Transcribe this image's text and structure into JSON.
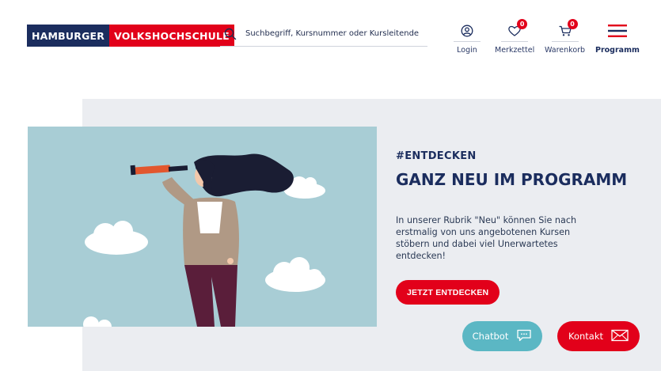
{
  "header": {
    "logo": {
      "part1": "HAMBURGER",
      "part2": "VOLKSHOCHSCHULE"
    },
    "search": {
      "placeholder": "Suchbegriff, Kursnummer oder Kursleitende",
      "icon": "search-icon"
    },
    "nav": [
      {
        "label": "Login",
        "icon": "user-icon"
      },
      {
        "label": "Merkzettel",
        "icon": "heart-icon",
        "badge": "0"
      },
      {
        "label": "Warenkorb",
        "icon": "cart-icon",
        "badge": "0"
      },
      {
        "label": "Programm",
        "icon": "menu-icon"
      }
    ]
  },
  "hero": {
    "tag": "#ENTDECKEN",
    "headline": "GANZ NEU IM PROGRAMM",
    "description": "In unserer Rubrik \"Neu\" können Sie nach erstmalig von uns angebotenen Kursen stöbern und dabei viel Unerwartetes entdecken!",
    "cta_label": "JETZT ENTDECKEN"
  },
  "floating": {
    "chatbot_label": "Chatbot",
    "kontakt_label": "Kontakt"
  },
  "colors": {
    "brand_navy": "#1b2d5e",
    "brand_red": "#e2001a",
    "chatbot_teal": "#5bb7c4",
    "hero_background": "#ebedf1",
    "illustration_sky": "#a8cdd5"
  }
}
